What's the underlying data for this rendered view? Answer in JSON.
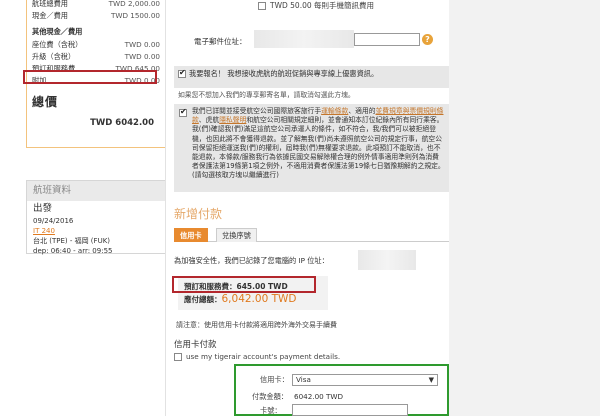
{
  "sidebar": {
    "fare_rows_top": [
      {
        "label": "航班總費用",
        "amount": "TWD 2,000.00"
      },
      {
        "label": "現金／費用",
        "amount": "TWD 1500.00"
      }
    ],
    "section_other": "其他現金／費用",
    "fare_rows_other": [
      {
        "label": "座位費（含稅）",
        "amount": "TWD 0.00"
      },
      {
        "label": "升級（含稅）",
        "amount": "TWD 0.00"
      },
      {
        "label": "預訂和服務費",
        "amount": "TWD 645.00"
      },
      {
        "label": "附加",
        "amount": "TWD 0.00"
      }
    ],
    "total_label": "總價",
    "total_amount": "TWD 6042.00",
    "flight": {
      "header": "航班資料",
      "direction": "出發",
      "date": "09/24/2016",
      "flight_no": "IT 240",
      "route": "台北 (TPE) - 福岡 (FUK)",
      "times": "dep: 06:40 - arr: 09:55"
    }
  },
  "main": {
    "top_fee_option": "TWD 50.00 每則手機簡訊費用",
    "email_label": "電子郵件位址：",
    "help_icon_glyph": "?",
    "promo_checkbox_label": "我要報名！ 我想接收虎航的航班促銷與專享線上優惠資訊。",
    "promo_note": "如果您不想加入我們的專享郵寄名單，請取消勾選此方塊。",
    "terms_text_1": "我們已詳閱並接受航空公司國際旅客旅行手",
    "terms_link_1": "運輸條款",
    "terms_text_2": "、適用的",
    "terms_link_2": "並費規章與票價規則條款",
    "terms_text_3": "、虎航",
    "terms_link_3": "隱私聲明",
    "terms_text_4": "和航空公司相關規定細則，並會通知本訂位紀錄內所有同行乘客。我(們)確認我(們)滿足這航空公司承運人的條件，如不符合，我/我們可以被拒絕登機，也因此將不會獲得退款。並了解無我(們)尚未遵照航空公司的規定行事，航空公司保留拒絕運送我(們)的權利，屆時我(們)無權要求退款。此項預訂不能取消，也不能退款，本條款/服務我行為依據民國交易解除權合理的例外情事適用準則列為消費者保護法第19條第1項之例外，不適用消費者保護法第19條七日猶豫期解約之規定。(請勾選核取方塊以繼續進行)",
    "payment_title": "新增付款",
    "tab_credit": "信用卡",
    "tab_voucher": "兌換序號",
    "ip_text": "為加強安全性，我們已記錄了您電腦的 IP 位址：",
    "fee_line": "預訂和服務費：645.00 TWD",
    "total_prefix": "應付總額：",
    "total_value": "6,042.00 TWD",
    "fx_note": "請注意：使用信用卡付款將適用跨外海外交易手續費",
    "cc_section_title": "信用卡付款",
    "use_account_label": "use my tigerair account's payment details.",
    "cc_card_label": "信用卡：",
    "cc_card_value": "Visa",
    "cc_amount_label": "付款金額：",
    "cc_amount_value": "6042.00 TWD",
    "cc_number_label": "卡號："
  },
  "colors": {
    "accent_orange": "#e88a2f",
    "highlight_red": "#b3272d",
    "highlight_green": "#2e9a2e",
    "sidebar_border": "#f3c37d"
  }
}
